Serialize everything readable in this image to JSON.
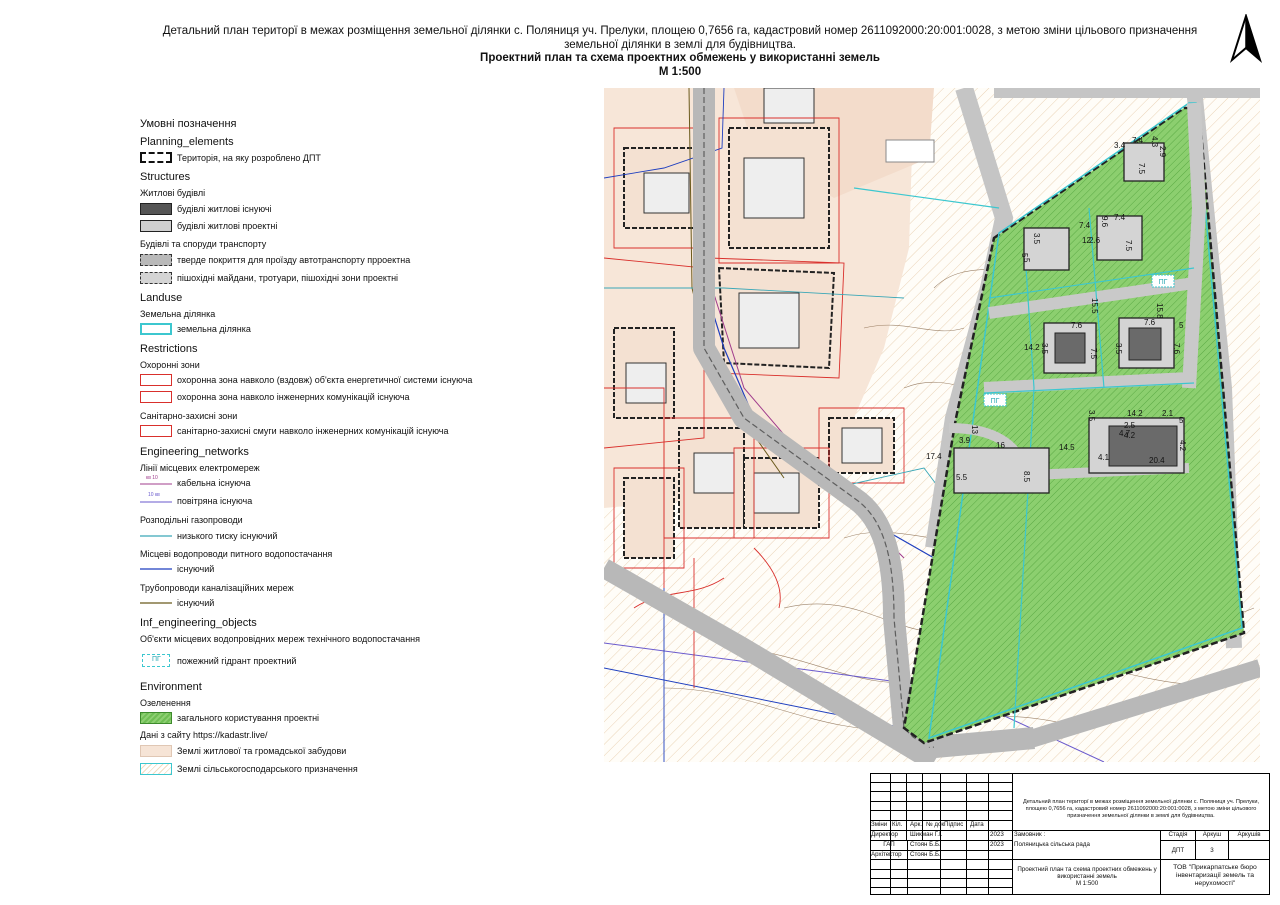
{
  "header": {
    "line1": "Детальний план територї в межах розміщення земельної ділянки с. Поляниця уч. Прелуки, площею 0,7656 га, кадастровий номер 2611092000:20:001:0028,  з метою зміни цільового призначення",
    "line1b": "земельної ділянки в землі для будівництва.",
    "line2": "Проектний план та схема проектних обмежень у використанні земель",
    "line3": "М 1:500"
  },
  "legend": {
    "title": "Умовні позначення",
    "planning_heading": "Planning_elements",
    "planning_item": "Територія, на яку розроблено ДПТ",
    "structures_heading": "Structures",
    "residential_sub": "Житлові будівлі",
    "residential_existing": "будівлі житлові існуючі",
    "residential_projected": "будівлі житлові проектні",
    "transport_sub": "Будівлі та споруди транспорту",
    "transport_hard": "тверде покриття для проїзду автотранспорту прроектна",
    "transport_pedestrian": "пішохідні майдани, тротуари, пішохідні зони проектні",
    "landuse_heading": "Landuse",
    "landuse_sub": "Земельна ділянка",
    "landuse_item": "земельна ділянка",
    "restrictions_heading": "Restrictions",
    "protect_sub": "Охоронні зони",
    "protect_energy": "охоронна зона навколо (вздовж) об'єкта енергетичної системи існуюча",
    "protect_engineering": "охоронна зона навколо інженерних комунікацій існуюча",
    "sanitary_sub": "Санітарно-захисні зони",
    "sanitary_item": "санітарно-захисні смуги навколо інженерних комунікацій існуюча",
    "engineering_heading": "Engineering_networks",
    "power_sub": "Лінії місцевих електромереж",
    "power_cable": "кабельна існуюча",
    "power_cable_tag": "кв 10",
    "power_air": "повітряна існуюча",
    "power_air_tag": "10 кв",
    "gas_sub": "Розподільні газопроводи",
    "gas_low": "низького тиску існуючий",
    "water_sub": "Місцеві водопроводи питного водопостачання",
    "water_existing": "існуючий",
    "sewer_sub": "Трубопроводи каналізаційних мереж",
    "sewer_existing": "існуючий",
    "inf_heading": "Inf_engineering_objects",
    "tech_water_sub": "Об'єкти місцевих водопровідних мереж технічного водопостачання",
    "hydrant": "пожежний гідрант проектний",
    "hydrant_tag": "ПГ",
    "environment_heading": "Environment",
    "greening_sub": "Озеленення",
    "greening_item": "загального користування проектні",
    "kadastr_sub": "Дані  з сайту https://kadastr.live/",
    "kadastr_residential": "Землі житлової та громадської забудови",
    "kadastr_agri": "Землі сільськогосподарського призначення"
  },
  "map": {
    "dims": [
      "3.4",
      "7.4",
      "7.5",
      "4.3",
      "2.9",
      "7.4",
      "3.5",
      "9.6",
      "7.4",
      "7.5",
      "5",
      "2.6",
      "12",
      "5",
      "15.5",
      "15.8",
      "7.6",
      "7.6",
      "3.5",
      "3.5",
      "7.5",
      "7.6",
      "5",
      "14.2",
      "14.2",
      "3.5",
      "2.1",
      "5",
      "2.5",
      "4.2",
      "4.7",
      "4.2",
      "4.1",
      "20.4",
      "13",
      "3.9",
      "16",
      "17.4",
      "14.5",
      "8.5",
      "5.5"
    ],
    "hydrant_tag": "ПГ"
  },
  "stamp": {
    "desc": "Детальний план територї в межах розміщення земельної ділянки с. Поляниця уч. Прелуки, площею 0,7656 га, кадастровий номер 2611092000:20:001:0028,  з метою зміни цільового призначення земельної ділянки в землі для будівництва.",
    "col_headers": [
      "Зміни",
      "Кіл.",
      "Арк.",
      "№ док",
      "Підпис",
      "Дата"
    ],
    "roles": [
      "Директор",
      "ГАП",
      "Архітектор"
    ],
    "names": [
      "Шикман Г.І.",
      "Стоян Б.Б.",
      "Стоян Б.Б."
    ],
    "dates": [
      "2023",
      "2023",
      ""
    ],
    "customer_label": "Замовник :",
    "customer": "Поляницька сільська рада",
    "stage_label": "Стадія",
    "sheet_label": "Аркуш",
    "sheets_label": "Аркушів",
    "stage": "ДПТ",
    "sheet": "3",
    "sheet_title": "Проектний план та схема проектних обмежень у використанні земель",
    "scale": "М 1:500",
    "company": "ТОВ \"Прикарпатське бюро інвентаризації земель та нерухомості\""
  }
}
